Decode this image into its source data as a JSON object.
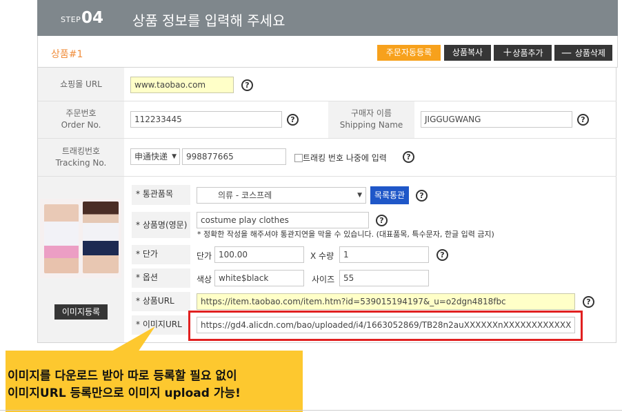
{
  "header": {
    "step_label": "STEP",
    "step_number": "04",
    "title": "상품 정보를 입력해 주세요"
  },
  "product_bar": {
    "label": "상품#1",
    "buttons": {
      "auto_order": "주문자동등록",
      "copy": "상품복사",
      "add": "상품추가",
      "delete": "상품삭제"
    }
  },
  "form": {
    "mall_url": {
      "label": "쇼핑몰 URL",
      "value": "www.taobao.com"
    },
    "order_no": {
      "label_ko": "주문번호",
      "label_en": "Order No.",
      "value": "112233445"
    },
    "shipping_name": {
      "label_ko": "구매자 이름",
      "label_en": "Shipping Name",
      "value": "JIGGUGWANG"
    },
    "tracking": {
      "label_ko": "트래킹번호",
      "label_en": "Tracking No.",
      "carrier": "申通快递",
      "value": "998877665",
      "later_checkbox_label": "트래킹 번호 나중에 입력"
    },
    "customs": {
      "label": "통관품목",
      "selected": "의류 - 코스프레",
      "list_button": "목록통관"
    },
    "product_name": {
      "label": "상품명(영문)",
      "value": "costume play clothes",
      "note": "* 정확한 작성을 해주셔야 통관지연을 막을 수 있습니다. (대표품목, 특수문자, 한글 입력 금지)"
    },
    "price": {
      "label": "단가",
      "price_label": "단가",
      "price_value": "100.00",
      "qty_label": "X 수량",
      "qty_value": "1"
    },
    "option": {
      "label": "옵션",
      "color_label": "색상",
      "color_value": "white$black",
      "size_label": "사이즈",
      "size_value": "55"
    },
    "product_url": {
      "label": "상품URL",
      "value": "https://item.taobao.com/item.htm?id=539015194197&_u=o2dgn4818fbc"
    },
    "image_url": {
      "label": "이미지URL",
      "value": "https://gd4.alicdn.com/bao/uploaded/i4/1663052869/TB28n2auXXXXXXnXXXXXXXXXXXX"
    },
    "image_register_button": "이미지등록",
    "help_glyph": "?",
    "star_glyph": "*",
    "dropdown_glyph": "▼"
  },
  "callout": {
    "line1": "이미지를 다운로드 받아 따로 등록할 필요 없이",
    "line2": "이미지URL 등록만으로 이미지 upload 가능!"
  },
  "colors": {
    "header_bg": "#7f878c",
    "accent_orange": "#f7a11c",
    "dark_button": "#363636",
    "highlight_red": "#e12020",
    "callout_yellow": "#fdc82f"
  }
}
